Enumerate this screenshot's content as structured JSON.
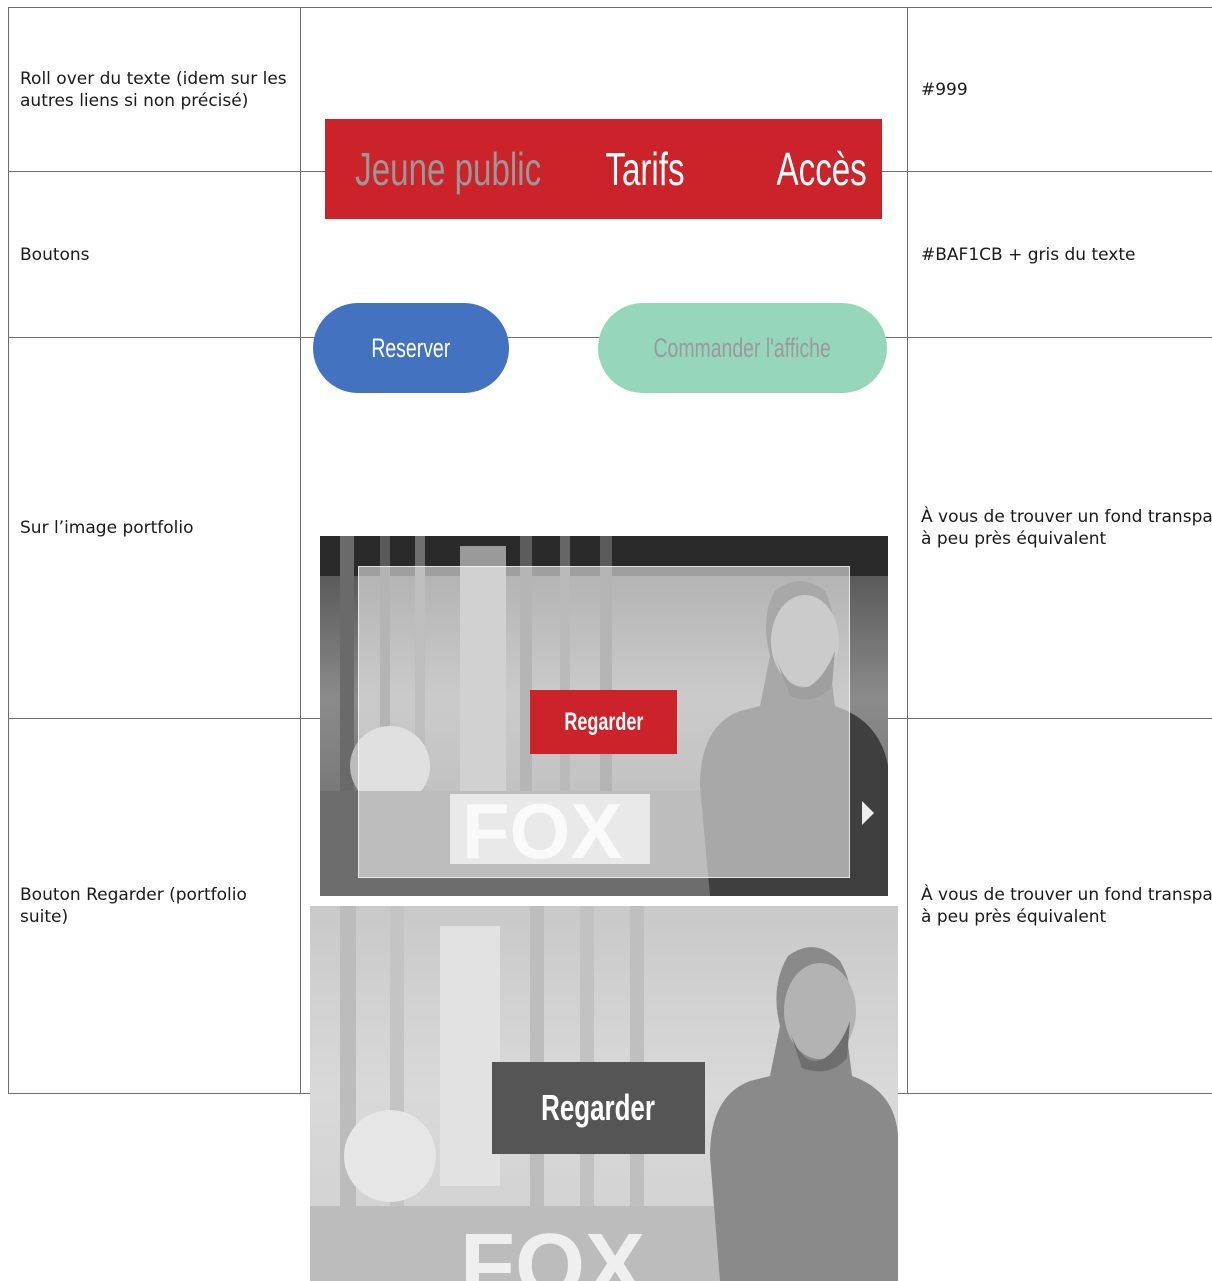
{
  "rows": [
    {
      "label": "Roll over du texte (idem sur les autres liens si non précisé)",
      "nav_items": [
        "Jeune public",
        "Tarifs",
        "Accès"
      ],
      "note": "#999"
    },
    {
      "label": "Boutons",
      "buttons": [
        "Reserver",
        "Commander l'affiche"
      ],
      "note": "#BAF1CB + gris du texte"
    },
    {
      "label": "Sur l’image portfolio",
      "photo_sign": "FOX",
      "button": "Regarder",
      "note": "À vous de trouver un fond transparent à peu près équivalent"
    },
    {
      "label": "Bouton Regarder (portfolio suite)",
      "photo_sign": "FOX",
      "button": "Regarder",
      "note": "À vous de trouver un fond transparent à peu près équivalent"
    }
  ],
  "colors": {
    "nav_bg": "#cc2229",
    "nav_hover_text": "#999999",
    "button_blue": "#4373c0",
    "button_green": "#96d7bb",
    "button_green_text": "#9a9a9a",
    "regarder_red": "#cc2229",
    "regarder_dark": "#555555"
  }
}
